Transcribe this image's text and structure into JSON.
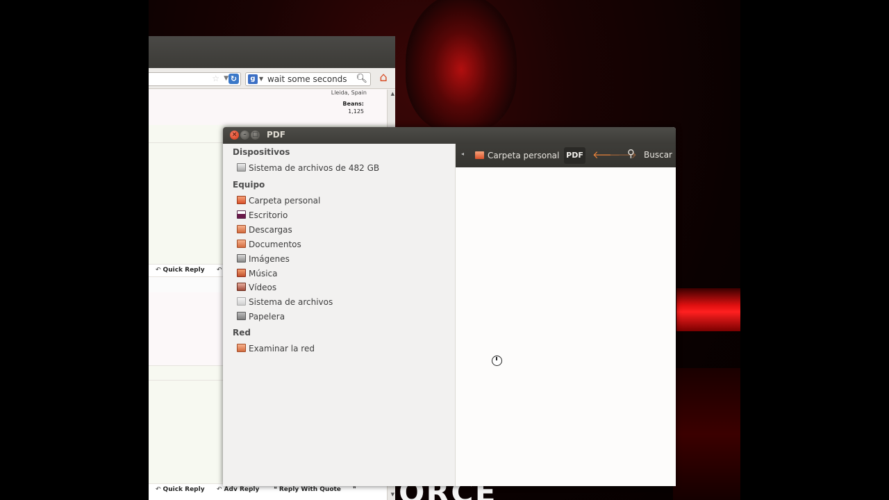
{
  "browser": {
    "search_text": "wait some seconds",
    "user_location": "Lleida, Spain",
    "beans_label": "Beans:",
    "beans_value": "1,125",
    "reply_bar_1": {
      "quick_reply": "Quick Reply"
    },
    "reply_bar_2": {
      "quick_reply": "Quick Reply",
      "adv_reply": "Adv Reply",
      "reply_with_quote": "Reply With Quote"
    }
  },
  "nautilus": {
    "title": "PDF",
    "sidebar": {
      "headings": {
        "devices": "Dispositivos",
        "computer": "Equipo",
        "network": "Red"
      },
      "devices": [
        {
          "label": "Sistema de archivos de 482 GB",
          "icon": "drive-icon"
        }
      ],
      "computer": [
        {
          "label": "Carpeta personal",
          "icon": "home-folder-icon"
        },
        {
          "label": "Escritorio",
          "icon": "desktop-folder-icon"
        },
        {
          "label": "Descargas",
          "icon": "downloads-folder-icon"
        },
        {
          "label": "Documentos",
          "icon": "documents-folder-icon"
        },
        {
          "label": "Imágenes",
          "icon": "pictures-folder-icon"
        },
        {
          "label": "Música",
          "icon": "music-folder-icon"
        },
        {
          "label": "Vídeos",
          "icon": "videos-folder-icon"
        },
        {
          "label": "Sistema de archivos",
          "icon": "filesystem-icon"
        },
        {
          "label": "Papelera",
          "icon": "trash-icon"
        }
      ],
      "network": [
        {
          "label": "Examinar la red",
          "icon": "network-icon"
        }
      ]
    },
    "toolbar": {
      "path_home": "Carpeta personal",
      "path_current": "PDF",
      "search_label": "Buscar"
    }
  },
  "wallpaper": {
    "logo_text": "ORCE"
  },
  "colors": {
    "accent_orange": "#e8823a",
    "titlebar": "#3d3c38",
    "close_red": "#dc4a2a"
  }
}
